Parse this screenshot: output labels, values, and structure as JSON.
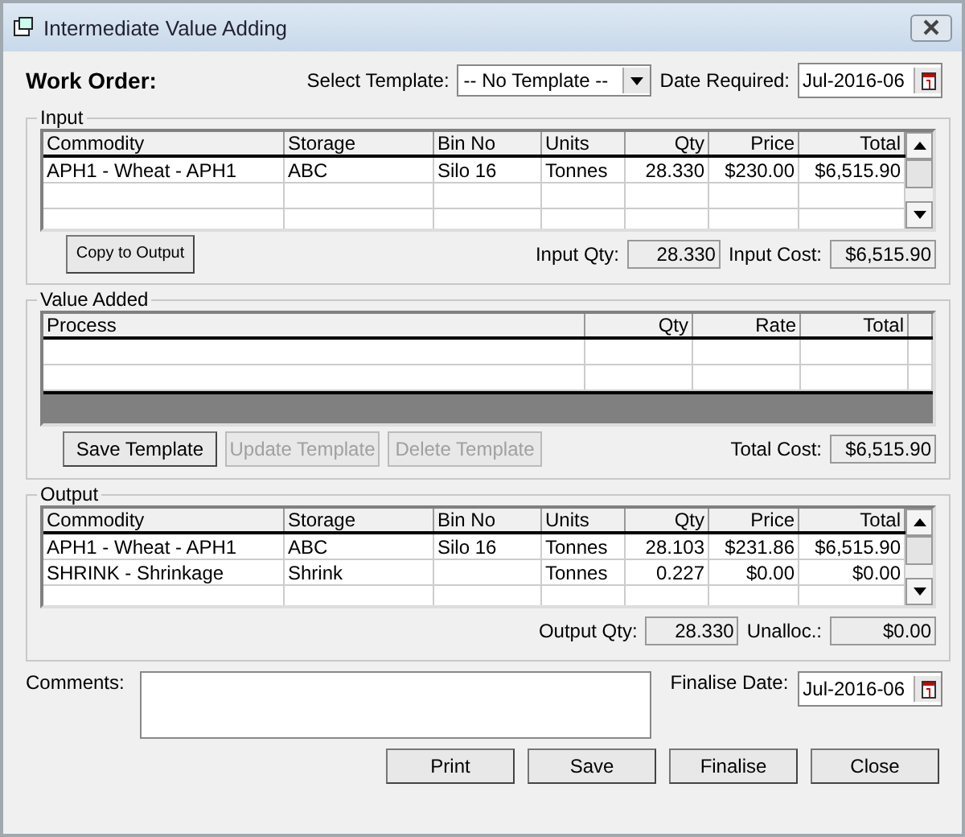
{
  "window": {
    "title": "Intermediate Value Adding"
  },
  "work_order": {
    "label": "Work Order:"
  },
  "template": {
    "label": "Select Template:",
    "value": "-- No Template --"
  },
  "date_required": {
    "label": "Date Required:",
    "value": "Jul-2016-06"
  },
  "input": {
    "title": "Input",
    "columns": [
      "Commodity",
      "Storage",
      "Bin No",
      "Units",
      "Qty",
      "Price",
      "Total"
    ],
    "rows": [
      [
        "APH1 - Wheat - APH1",
        "ABC",
        "Silo 16",
        "Tonnes",
        "28.330",
        "$230.00",
        "$6,515.90"
      ]
    ],
    "copy_button": "Copy to Output",
    "qty": {
      "label": "Input Qty:",
      "value": "28.330"
    },
    "cost": {
      "label": "Input Cost:",
      "value": "$6,515.90"
    }
  },
  "value_added": {
    "title": "Value Added",
    "columns": [
      "Process",
      "Qty",
      "Rate",
      "Total"
    ],
    "buttons": [
      {
        "label": "Save Template",
        "disabled": false
      },
      {
        "label": "Update Template",
        "disabled": true
      },
      {
        "label": "Delete Template",
        "disabled": true
      }
    ],
    "total_cost": {
      "label": "Total Cost:",
      "value": "$6,515.90"
    }
  },
  "output": {
    "title": "Output",
    "columns": [
      "Commodity",
      "Storage",
      "Bin No",
      "Units",
      "Qty",
      "Price",
      "Total"
    ],
    "rows": [
      [
        "APH1 - Wheat - APH1",
        "ABC",
        "Silo 16",
        "Tonnes",
        "28.103",
        "$231.86",
        "$6,515.90"
      ],
      [
        "SHRINK - Shrinkage",
        "Shrink",
        "",
        "Tonnes",
        "0.227",
        "$0.00",
        "$0.00"
      ]
    ],
    "qty": {
      "label": "Output Qty:",
      "value": "28.330"
    },
    "unalloc": {
      "label": "Unalloc.:",
      "value": "$0.00"
    }
  },
  "comments": {
    "label": "Comments:"
  },
  "finalise_date": {
    "label": "Finalise Date:",
    "value": "Jul-2016-06"
  },
  "buttons": [
    "Print",
    "Save",
    "Finalise",
    "Close"
  ]
}
